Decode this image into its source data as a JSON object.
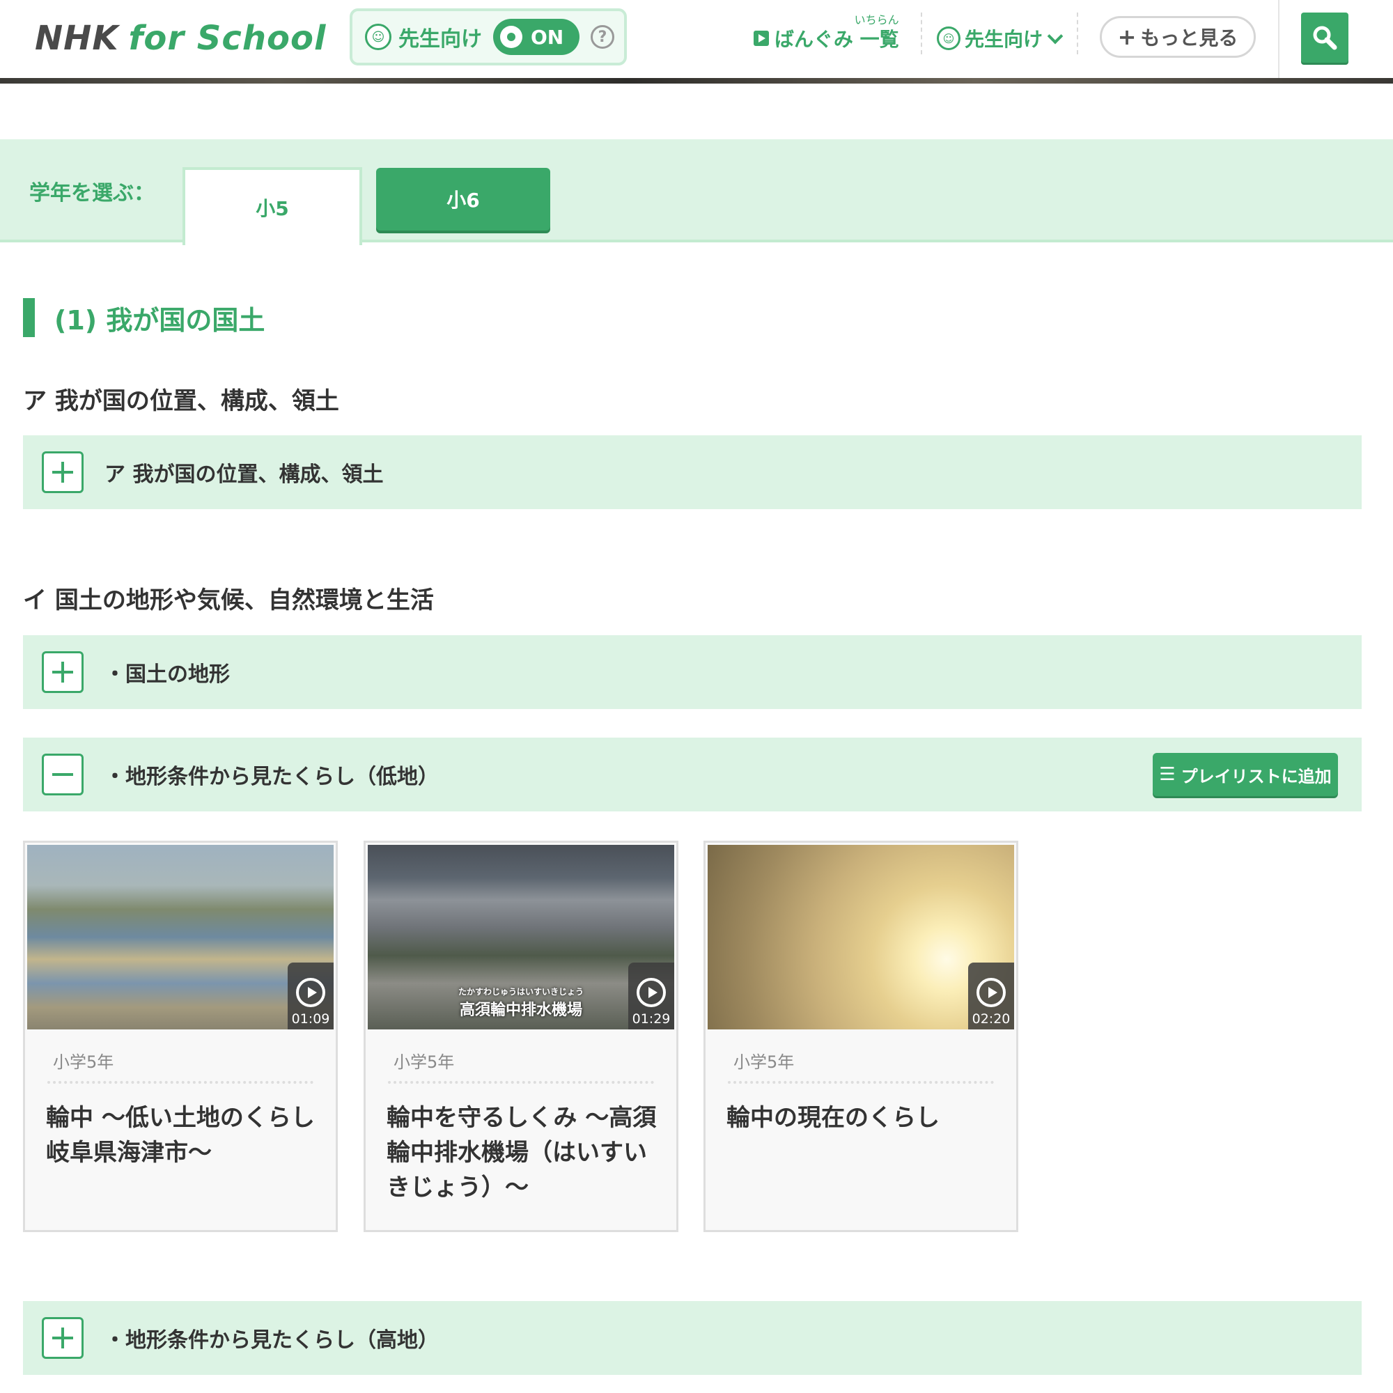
{
  "header": {
    "logo_nhk": "NHK",
    "logo_for_school": "for School",
    "teacher_toggle": {
      "label": "先生向け",
      "state": "ON",
      "help": "?"
    },
    "nav_list": {
      "label": "ばんぐみ 一覧",
      "ruby": "いちらん"
    },
    "teacher_menu": {
      "label": "先生向け"
    },
    "more_button": "もっと見る"
  },
  "grade_selector": {
    "label": "学年を選ぶ：",
    "tabs": [
      {
        "label": "小5",
        "active": true
      },
      {
        "label": "小6",
        "active": false
      }
    ]
  },
  "section": {
    "title": "(1) 我が国の国土",
    "subsections": [
      {
        "heading": "ア 我が国の位置、構成、領土",
        "items": [
          {
            "title": "ア 我が国の位置、構成、領土",
            "expanded": false
          }
        ]
      },
      {
        "heading": "イ 国土の地形や気候、自然環境と生活",
        "items": [
          {
            "title": "・国土の地形",
            "expanded": false
          },
          {
            "title": "・地形条件から見たくらし（低地）",
            "expanded": true,
            "playlist_button": "プレイリストに追加"
          },
          {
            "title": "・地形条件から見たくらし（高地）",
            "expanded": false
          }
        ]
      }
    ]
  },
  "videos": [
    {
      "grade": "小学5年",
      "title": "輪中 〜低い土地のくらし 岐阜県海津市〜",
      "duration": "01:09"
    },
    {
      "grade": "小学5年",
      "title": "輪中を守るしくみ 〜高須輪中排水機場（はいすいきじょう）〜",
      "duration": "01:29",
      "thumb_caption": "高須輪中排水機場",
      "thumb_caption_ruby": "たかすわじゅうはいすいきじょう"
    },
    {
      "grade": "小学5年",
      "title": "輪中の現在のくらし",
      "duration": "02:20"
    }
  ],
  "colors": {
    "accent": "#3aa869",
    "panel": "#dcf3e4"
  }
}
